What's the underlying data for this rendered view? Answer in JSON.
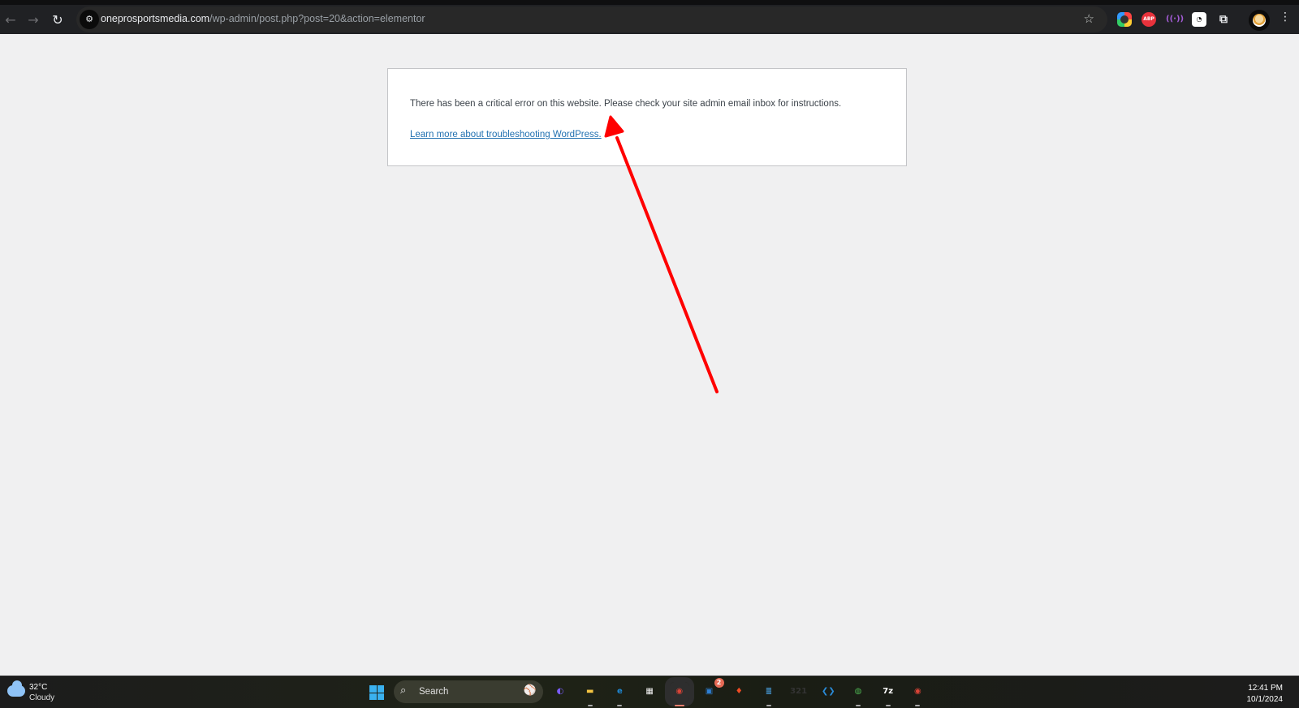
{
  "browser": {
    "url_host": "oneprosportsmedia.com",
    "url_path": "/wp-admin/post.php?post=20&action=elementor",
    "nav": {
      "back_icon": "←",
      "forward_icon": "→",
      "reload_icon": "↻",
      "site_info_icon": "⚙"
    },
    "bookmark_icon": "☆",
    "extensions": [
      {
        "name": "screen-capture-extension",
        "glyph": ""
      },
      {
        "name": "adblock-plus-extension",
        "glyph": "ABP"
      },
      {
        "name": "radio-extension",
        "glyph": "((·))"
      },
      {
        "name": "clock-extension",
        "glyph": "◔"
      },
      {
        "name": "extensions-puzzle",
        "glyph": "⧉"
      }
    ],
    "menu_icon": "⋮"
  },
  "page": {
    "error_message": "There has been a critical error on this website. Please check your site admin email inbox for instructions.",
    "help_link": "Learn more about troubleshooting WordPress."
  },
  "annotation": {
    "color": "#ff0000"
  },
  "taskbar": {
    "weather": {
      "temperature": "32°C",
      "condition": "Cloudy"
    },
    "search_label": "Search",
    "search_icon": "⌕",
    "search_deco": "⚾",
    "apps": [
      {
        "name": "copilot",
        "glyph": "◐",
        "color": "#7a5cff"
      },
      {
        "name": "file-explorer",
        "glyph": "▬",
        "color": "#f5c542",
        "running": true
      },
      {
        "name": "edge",
        "glyph": "e",
        "color": "#1e88d4",
        "running": true
      },
      {
        "name": "microsoft-store",
        "glyph": "▦",
        "color": "#f2f2f2"
      },
      {
        "name": "chrome-profile-1",
        "glyph": "◉",
        "color": "#db4437",
        "active": true
      },
      {
        "name": "phone-link",
        "glyph": "▣",
        "color": "#2d7fd4",
        "badge": "2"
      },
      {
        "name": "brave",
        "glyph": "♦",
        "color": "#f04c24"
      },
      {
        "name": "notepad",
        "glyph": "≣",
        "color": "#4aa3e6",
        "running": true
      },
      {
        "name": "media-player-classic",
        "glyph": "321",
        "color": "#333"
      },
      {
        "name": "vs-code",
        "glyph": "❮❯",
        "color": "#2a8bd8"
      },
      {
        "name": "download-manager",
        "glyph": "◍",
        "color": "#4caf50",
        "running": true
      },
      {
        "name": "7-zip",
        "glyph": "7z",
        "color": "#fff",
        "running": true
      },
      {
        "name": "chrome-profile-2",
        "glyph": "◉",
        "color": "#db4437",
        "running": true
      }
    ],
    "time": "12:41 PM",
    "date": "10/1/2024"
  }
}
